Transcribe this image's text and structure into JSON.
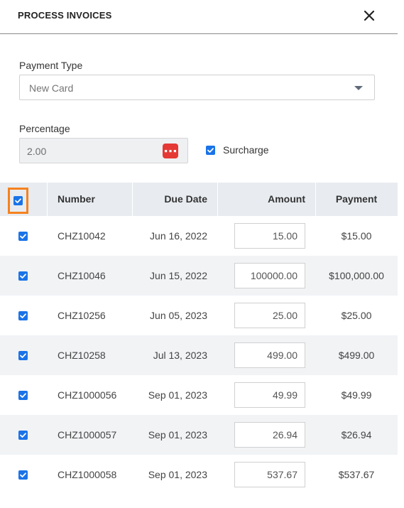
{
  "header": {
    "title": "PROCESS INVOICES"
  },
  "payment_type": {
    "label": "Payment Type",
    "value": "New Card"
  },
  "percentage": {
    "label": "Percentage",
    "value": "2.00"
  },
  "surcharge": {
    "label": "Surcharge",
    "checked": true
  },
  "table": {
    "columns": {
      "number": "Number",
      "due_date": "Due Date",
      "amount": "Amount",
      "payment": "Payment"
    },
    "select_all_checked": true,
    "rows": [
      {
        "checked": true,
        "number": "CHZ10042",
        "due_date": "Jun 16, 2022",
        "amount": "15.00",
        "payment": "$15.00"
      },
      {
        "checked": true,
        "number": "CHZ10046",
        "due_date": "Jun 15, 2022",
        "amount": "100000.00",
        "payment": "$100,000.00"
      },
      {
        "checked": true,
        "number": "CHZ10256",
        "due_date": "Jun 05, 2023",
        "amount": "25.00",
        "payment": "$25.00"
      },
      {
        "checked": true,
        "number": "CHZ10258",
        "due_date": "Jul 13, 2023",
        "amount": "499.00",
        "payment": "$499.00"
      },
      {
        "checked": true,
        "number": "CHZ1000056",
        "due_date": "Sep 01, 2023",
        "amount": "49.99",
        "payment": "$49.99"
      },
      {
        "checked": true,
        "number": "CHZ1000057",
        "due_date": "Sep 01, 2023",
        "amount": "26.94",
        "payment": "$26.94"
      },
      {
        "checked": true,
        "number": "CHZ1000058",
        "due_date": "Sep 01, 2023",
        "amount": "537.67",
        "payment": "$537.67"
      }
    ]
  },
  "colors": {
    "accent": "#1a73e8",
    "highlight": "#f5821f",
    "icon_red": "#e53935",
    "header_bg": "#e8ecf0"
  },
  "icons": {
    "close": "close-icon",
    "caret": "chevron-down-icon",
    "dots": "more-dots-icon",
    "check": "check-icon"
  }
}
